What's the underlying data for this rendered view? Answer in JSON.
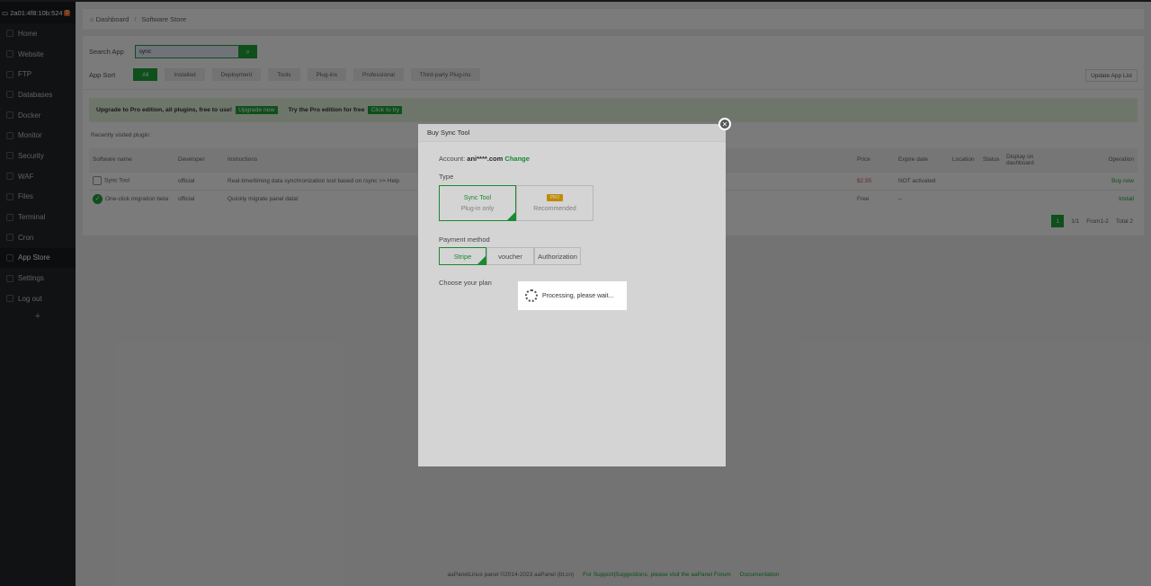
{
  "sidebar": {
    "host": "2a01:4f8:10b:524",
    "badge": "0",
    "items": [
      {
        "label": "Home"
      },
      {
        "label": "Website"
      },
      {
        "label": "FTP"
      },
      {
        "label": "Databases"
      },
      {
        "label": "Docker"
      },
      {
        "label": "Monitor"
      },
      {
        "label": "Security"
      },
      {
        "label": "WAF"
      },
      {
        "label": "Files"
      },
      {
        "label": "Terminal"
      },
      {
        "label": "Cron"
      },
      {
        "label": "App Store"
      },
      {
        "label": "Settings"
      },
      {
        "label": "Log out"
      }
    ],
    "add": "+"
  },
  "breadcrumb": {
    "home": "Dashboard",
    "sep": "/",
    "current": "Software Store"
  },
  "search": {
    "label": "Search App",
    "value": "sync"
  },
  "sort": {
    "label": "App Sort",
    "items": [
      "All",
      "Installed",
      "Deployment",
      "Tools",
      "Plug-ins",
      "Professional",
      "Third-party Plug-ins"
    ]
  },
  "update_btn": "Update App List",
  "promo": {
    "text": "Upgrade to Pro edition, all plugins, free to use!",
    "upgrade": "Upgrade now",
    "try_text": "Try the Pro edition for free",
    "try_btn": "Click to try"
  },
  "recent": "Recently visited plugin:",
  "table": {
    "headers": [
      "Software name",
      "Developer",
      "Instructions",
      "Price",
      "Expire date",
      "Location",
      "Status",
      "Display on dashboard",
      "Operation"
    ],
    "rows": [
      {
        "name": "Sync Tool",
        "dev": "official",
        "desc": "Real-time/timing data synchronization tool based on rsync >> Help",
        "price": "$2.95",
        "expire": "NOT activated",
        "op": "Buy now"
      },
      {
        "name": "One-click migration beta",
        "dev": "official",
        "desc": "Quickly migrate panel data!",
        "price": "Free",
        "expire": "--",
        "op": "Install"
      }
    ]
  },
  "pager": {
    "page": "1",
    "pages": "1/1",
    "range": "From1-2",
    "total": "Total 2"
  },
  "footer": {
    "copyright": "aaPanelLinux panel ©2014-2023 aaPanel (bt.cn)",
    "support": "For Support|Suggestions, please visit the aaPanel Forum",
    "docs": "Documentation"
  },
  "modal": {
    "title": "Buy Sync Tool",
    "account_label": "Account:",
    "account": "ani****.com",
    "change": "Change",
    "type_label": "Type",
    "types": [
      {
        "title": "Sync Tool",
        "sub": "Plug-in only"
      },
      {
        "badge": "PRO",
        "sub": "Recommended"
      }
    ],
    "pay_label": "Payment method",
    "pays": [
      "Stripe",
      "voucher",
      "Authorization"
    ],
    "plan_label": "Choose your plan"
  },
  "loading": "Processing, please wait..."
}
